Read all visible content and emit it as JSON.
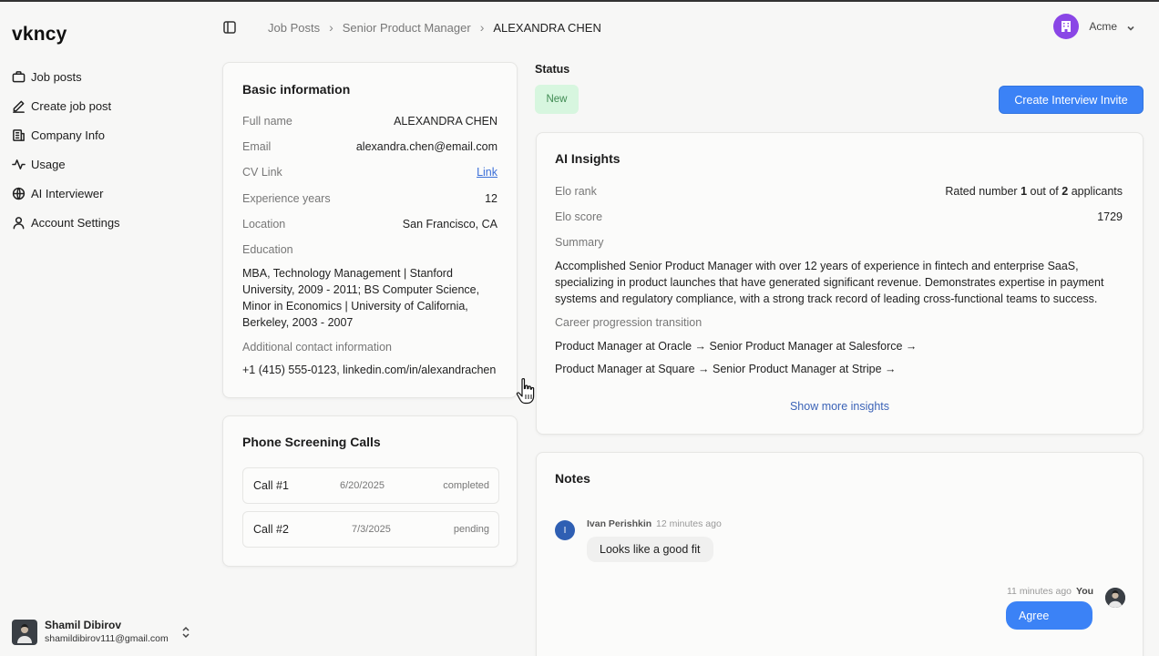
{
  "app": {
    "logo": "vkncy"
  },
  "sidebar": {
    "items": [
      {
        "label": "Job posts",
        "icon": "briefcase-icon"
      },
      {
        "label": "Create job post",
        "icon": "pencil-icon"
      },
      {
        "label": "Company Info",
        "icon": "building-icon"
      },
      {
        "label": "Usage",
        "icon": "activity-icon"
      },
      {
        "label": "AI Interviewer",
        "icon": "globe-icon"
      },
      {
        "label": "Account Settings",
        "icon": "user-icon"
      }
    ],
    "user": {
      "name": "Shamil Dibirov",
      "email": "shamildibirov111@gmail.com"
    }
  },
  "header": {
    "breadcrumb": [
      "Job Posts",
      "Senior Product Manager",
      "ALEXANDRA CHEN"
    ],
    "org": {
      "name": "Acme",
      "color": "#8a46e6"
    }
  },
  "basic_info": {
    "title": "Basic information",
    "full_name_label": "Full name",
    "full_name": "ALEXANDRA CHEN",
    "email_label": "Email",
    "email": "alexandra.chen@email.com",
    "cv_label": "CV Link",
    "cv_link": "Link",
    "experience_label": "Experience years",
    "experience": "12",
    "location_label": "Location",
    "location": "San Francisco, CA",
    "education_label": "Education",
    "education": "MBA, Technology Management | Stanford University, 2009 - 2011; BS Computer Science, Minor in Economics | University of California, Berkeley, 2003 - 2007",
    "contact_label": "Additional contact information",
    "contact": "+1 (415) 555-0123, linkedin.com/in/alexandrachen"
  },
  "phone_calls": {
    "title": "Phone Screening Calls",
    "calls": [
      {
        "name": "Call #1",
        "date": "6/20/2025",
        "status": "completed"
      },
      {
        "name": "Call #2",
        "date": "7/3/2025",
        "status": "pending"
      }
    ]
  },
  "status": {
    "label": "Status",
    "value": "New",
    "color": "#d7f6df",
    "invite_button": "Create Interview Invite",
    "accent": "#3b82f6"
  },
  "ai_insights": {
    "title": "AI Insights",
    "elo_rank_label": "Elo rank",
    "elo_rank_prefix": "Rated number",
    "elo_rank_number": "1",
    "elo_rank_mid": "out of",
    "elo_rank_total": "2",
    "elo_rank_suffix": "applicants",
    "elo_score_label": "Elo score",
    "elo_score": "1729",
    "summary_label": "Summary",
    "summary": "Accomplished Senior Product Manager with over 12 years of experience in fintech and enterprise SaaS, specializing in product launches that have generated significant revenue. Demonstrates expertise in payment systems and regulatory compliance, with a strong track record of leading cross-functional teams to success.",
    "career_label": "Career progression transition",
    "career": [
      "Product Manager at Oracle → Senior Product Manager at Salesforce →",
      "Product Manager at Square → Senior Product Manager at Stripe →"
    ],
    "show_more": "Show more insights"
  },
  "notes": {
    "title": "Notes",
    "entries": [
      {
        "avatar_initial": "I",
        "author": "Ivan Perishkin",
        "time": "12 minutes ago",
        "text": "Looks like a good fit"
      },
      {
        "author": "You",
        "time": "11 minutes ago",
        "text": "Agree"
      }
    ]
  }
}
